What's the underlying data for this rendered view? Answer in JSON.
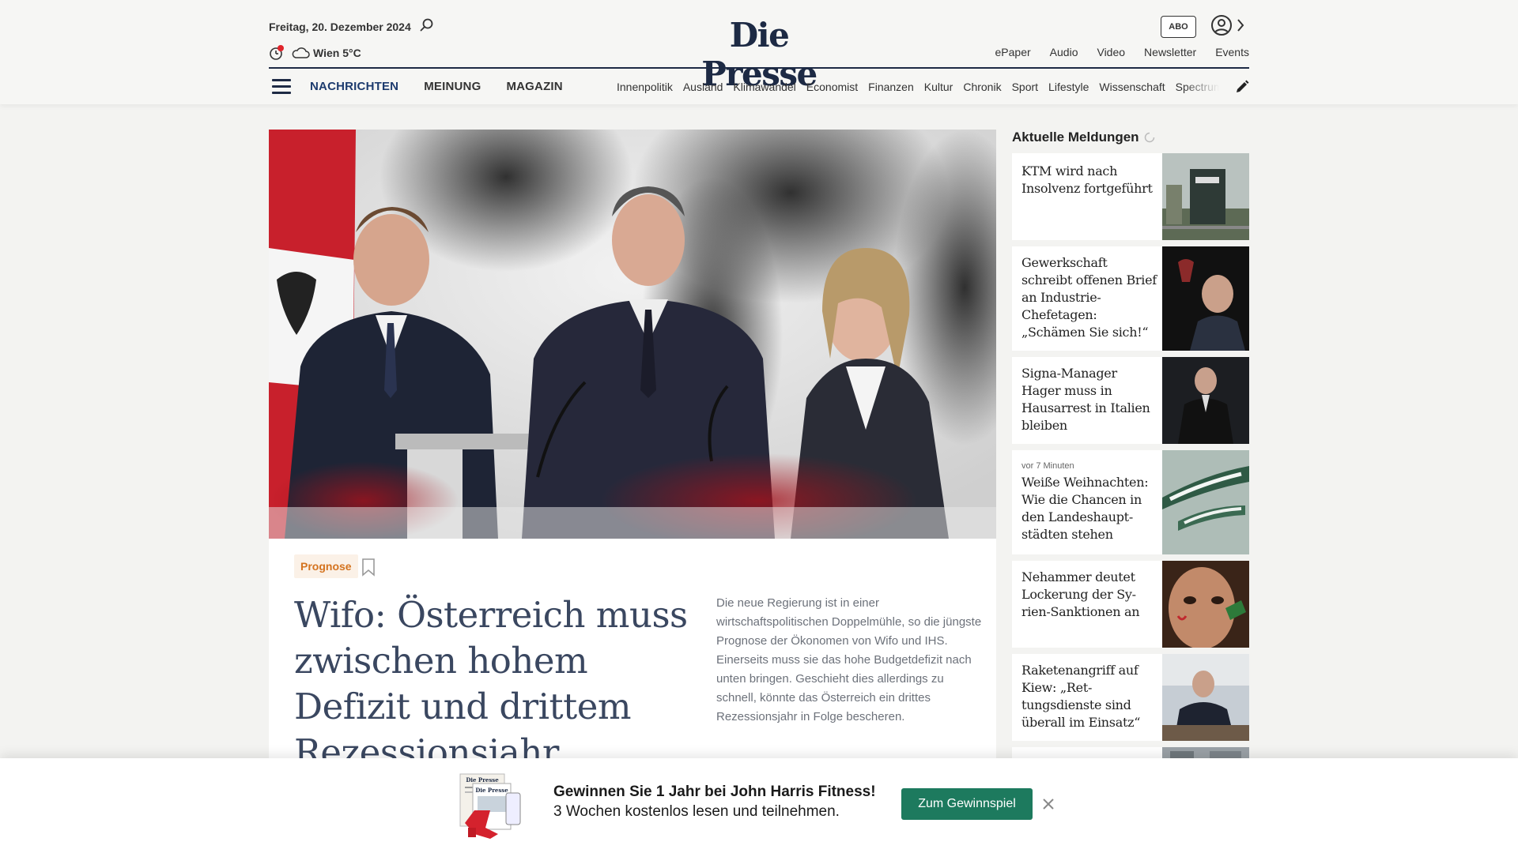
{
  "header": {
    "date": "Freitag, 20. Dezember 2024",
    "weather": "Wien 5°C",
    "logo": "Die Presse",
    "abo_label": "ABO",
    "links": [
      "ePaper",
      "Audio",
      "Video",
      "Newsletter",
      "Events"
    ],
    "sections": [
      {
        "label": "NACHRICHTEN",
        "active": true
      },
      {
        "label": "MEINUNG",
        "active": false
      },
      {
        "label": "MAGAZIN",
        "active": false
      }
    ],
    "subsections": [
      "Innenpolitik",
      "Ausland",
      "Klimawandel",
      "Economist",
      "Finanzen",
      "Kultur",
      "Chronik",
      "Sport",
      "Lifestyle",
      "Wissenschaft",
      "Spectrum"
    ]
  },
  "article": {
    "tag": "Prognose",
    "headline": "Wifo: Österreich muss zwischen hohem Defizit und drittem Rezessionsjahr wählen",
    "teaser": "Die neue Regierung ist in einer wirtschaftspolitischen Doppelmühle, so die jüngste Prognose der Ökonomen von Wifo und IHS. Einerseits muss sie das hohe Budgetdefizit nach unten bringen. Geschieht dies allerdings zu schnell, könnte das Österreich ein drittes Rezessionsjahr in Folge bescheren."
  },
  "sidebar": {
    "title": "Aktuelle Meldungen",
    "items": [
      {
        "time": "",
        "title": "KTM wird nach Insolvenz fortgeführt"
      },
      {
        "time": "",
        "title": "Gewerkschaft schreibt offenen Brief an Industrie-Chefetagen: „Schämen Sie sich!“"
      },
      {
        "time": "",
        "title": "Signa-Manager Hager muss in Hausarrest in Italien bleiben"
      },
      {
        "time": "vor 7 Minuten",
        "title": "Weiße Weihnachten: Wie die Chancen in den Landeshaupt­städten stehen"
      },
      {
        "time": "",
        "title": "Nehammer deutet Lockerung der Sy­rien-Sanktionen an"
      },
      {
        "time": "",
        "title": "Raketenangriff auf Kiew: „Ret­tungsdienste sind überall im Einsatz“"
      }
    ]
  },
  "promo": {
    "line1": "Gewinnen Sie 1 Jahr bei John Harris Fitness!",
    "line2": "3 Wochen kostenlos lesen und teilnehmen.",
    "button": "Zum Gewinnspiel",
    "image_label": "Die Presse"
  },
  "colors": {
    "brand_navy": "#1d2a44",
    "accent_orange": "#d4731f",
    "promo_green": "#1d7a5e"
  }
}
